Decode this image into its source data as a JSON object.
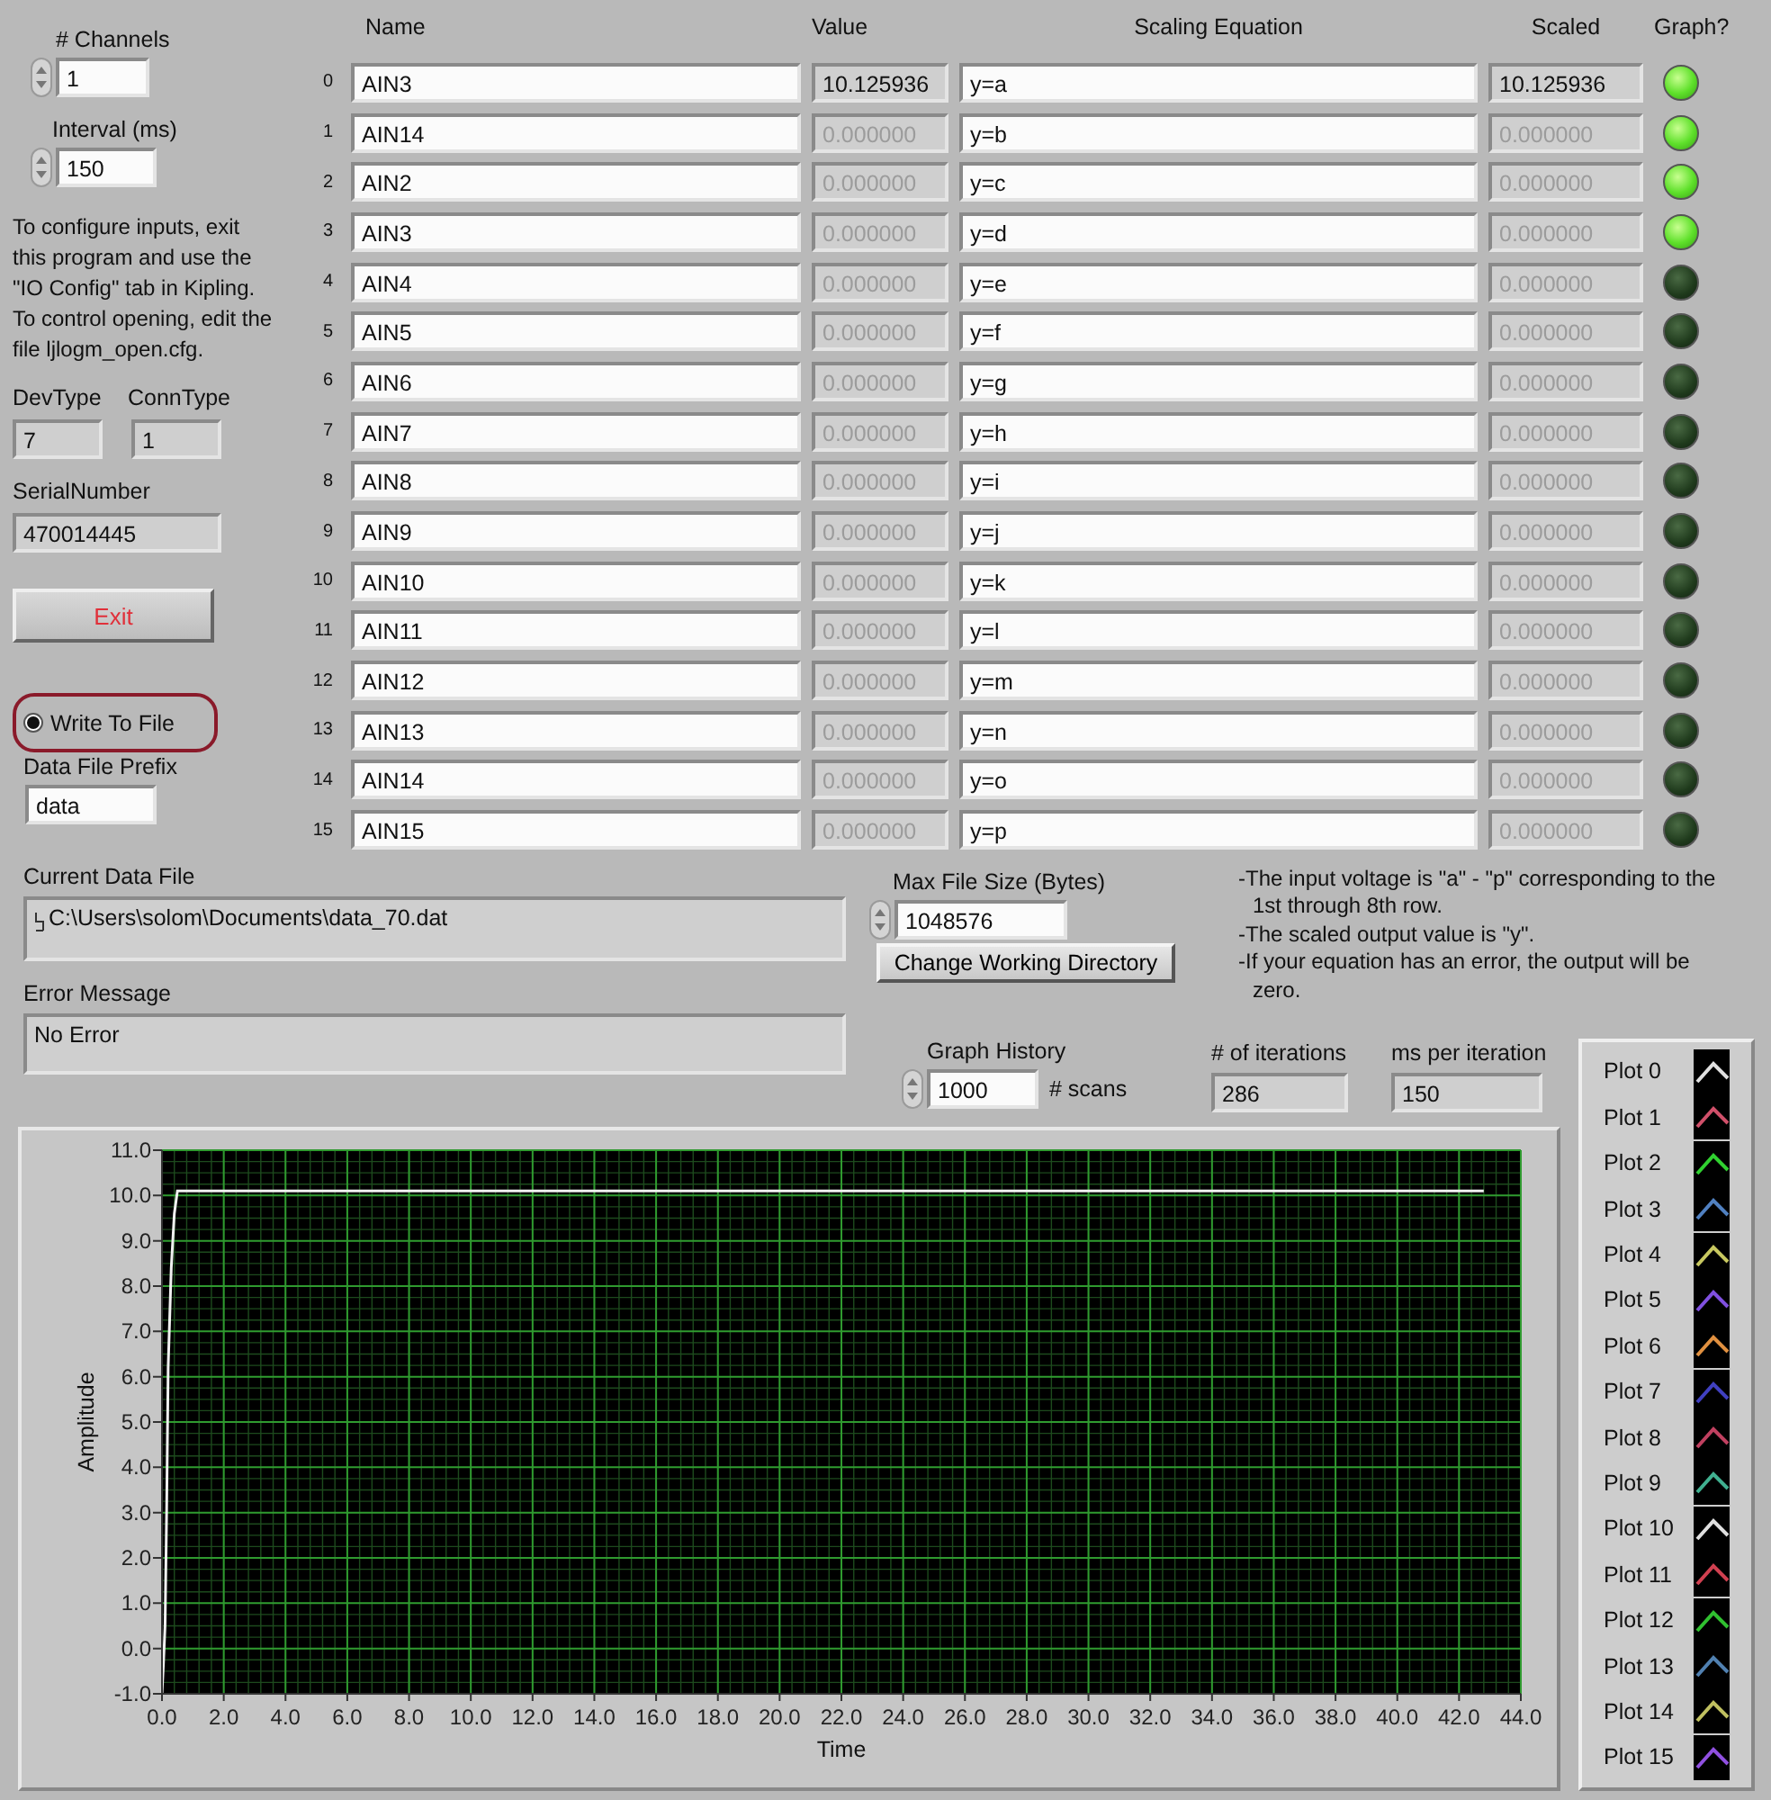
{
  "channels": {
    "label": "# Channels",
    "value": "1"
  },
  "interval": {
    "label": "Interval (ms)",
    "value": "150"
  },
  "instructions": "To configure inputs, exit this program and use the \"IO Config\" tab in Kipling.  To control opening, edit the file ljlogm_open.cfg.",
  "dev_type": {
    "label": "DevType",
    "value": "7"
  },
  "conn_type": {
    "label": "ConnType",
    "value": "1"
  },
  "serial_number": {
    "label": "SerialNumber",
    "value": "470014445"
  },
  "exit_button": "Exit",
  "write_to_file": {
    "label": "Write To File",
    "checked": true
  },
  "data_file_prefix": {
    "label": "Data File Prefix",
    "value": "data"
  },
  "table": {
    "columns": [
      "Name",
      "Value",
      "Scaling Equation",
      "Scaled",
      "Graph?"
    ],
    "rows": [
      {
        "index": "0",
        "name": "AIN3",
        "value": "10.125936",
        "equation": "y=a",
        "scaled": "10.125936",
        "disabled": false,
        "graph": true
      },
      {
        "index": "1",
        "name": "AIN14",
        "value": "0.000000",
        "equation": "y=b",
        "scaled": "0.000000",
        "disabled": true,
        "graph": true
      },
      {
        "index": "2",
        "name": "AIN2",
        "value": "0.000000",
        "equation": "y=c",
        "scaled": "0.000000",
        "disabled": true,
        "graph": true
      },
      {
        "index": "3",
        "name": "AIN3",
        "value": "0.000000",
        "equation": "y=d",
        "scaled": "0.000000",
        "disabled": true,
        "graph": true
      },
      {
        "index": "4",
        "name": "AIN4",
        "value": "0.000000",
        "equation": "y=e",
        "scaled": "0.000000",
        "disabled": true,
        "graph": false
      },
      {
        "index": "5",
        "name": "AIN5",
        "value": "0.000000",
        "equation": "y=f",
        "scaled": "0.000000",
        "disabled": true,
        "graph": false
      },
      {
        "index": "6",
        "name": "AIN6",
        "value": "0.000000",
        "equation": "y=g",
        "scaled": "0.000000",
        "disabled": true,
        "graph": false
      },
      {
        "index": "7",
        "name": "AIN7",
        "value": "0.000000",
        "equation": "y=h",
        "scaled": "0.000000",
        "disabled": true,
        "graph": false
      },
      {
        "index": "8",
        "name": "AIN8",
        "value": "0.000000",
        "equation": "y=i",
        "scaled": "0.000000",
        "disabled": true,
        "graph": false
      },
      {
        "index": "9",
        "name": "AIN9",
        "value": "0.000000",
        "equation": "y=j",
        "scaled": "0.000000",
        "disabled": true,
        "graph": false
      },
      {
        "index": "10",
        "name": "AIN10",
        "value": "0.000000",
        "equation": "y=k",
        "scaled": "0.000000",
        "disabled": true,
        "graph": false
      },
      {
        "index": "11",
        "name": "AIN11",
        "value": "0.000000",
        "equation": "y=l",
        "scaled": "0.000000",
        "disabled": true,
        "graph": false
      },
      {
        "index": "12",
        "name": "AIN12",
        "value": "0.000000",
        "equation": "y=m",
        "scaled": "0.000000",
        "disabled": true,
        "graph": false
      },
      {
        "index": "13",
        "name": "AIN13",
        "value": "0.000000",
        "equation": "y=n",
        "scaled": "0.000000",
        "disabled": true,
        "graph": false
      },
      {
        "index": "14",
        "name": "AIN14",
        "value": "0.000000",
        "equation": "y=o",
        "scaled": "0.000000",
        "disabled": true,
        "graph": false
      },
      {
        "index": "15",
        "name": "AIN15",
        "value": "0.000000",
        "equation": "y=p",
        "scaled": "0.000000",
        "disabled": true,
        "graph": false
      }
    ]
  },
  "current_data_file": {
    "label": "Current Data File",
    "value": "C:\\Users\\solom\\Documents\\data_70.dat"
  },
  "error_message": {
    "label": "Error Message",
    "value": "No Error"
  },
  "max_file_size": {
    "label": "Max File Size (Bytes)",
    "value": "1048576"
  },
  "change_directory_button": "Change Working Directory",
  "notes": [
    "-The input voltage is \"a\" - \"p\" corresponding to the 1st through 8th row.",
    "-The scaled output value is \"y\".",
    "-If your equation has an error, the output will be zero."
  ],
  "graph_history": {
    "label": "Graph History",
    "value": "1000",
    "unit": "# scans"
  },
  "iterations": {
    "label": "# of iterations",
    "value": "286"
  },
  "ms_per_iteration": {
    "label": "ms per iteration",
    "value": "150"
  },
  "chart": {
    "chart_data": {
      "type": "line",
      "grid": true,
      "xlabel": "Time",
      "ylabel": "Amplitude",
      "xlim": [
        0,
        44
      ],
      "ylim": [
        -1,
        11
      ],
      "x": [
        0,
        0.05,
        0.1,
        0.15,
        0.2,
        0.3,
        0.4,
        0.5,
        0.6,
        42.8
      ],
      "series": [
        {
          "color": "#f0f0f0",
          "values": [
            -1.0,
            -0.3,
            0.5,
            3.0,
            6.2,
            8.4,
            9.6,
            10.1,
            10.1,
            10.1
          ]
        }
      ],
      "xticks": [
        {
          "value": 0,
          "label": "0.0"
        },
        {
          "value": 2,
          "label": "2.0"
        },
        {
          "value": 4,
          "label": "4.0"
        },
        {
          "value": 6,
          "label": "6.0"
        },
        {
          "value": 8,
          "label": "8.0"
        },
        {
          "value": 10,
          "label": "10.0"
        },
        {
          "value": 12,
          "label": "12.0"
        },
        {
          "value": 14,
          "label": "14.0"
        },
        {
          "value": 16,
          "label": "16.0"
        },
        {
          "value": 18,
          "label": "18.0"
        },
        {
          "value": 20,
          "label": "20.0"
        },
        {
          "value": 22,
          "label": "22.0"
        },
        {
          "value": 24,
          "label": "24.0"
        },
        {
          "value": 26,
          "label": "26.0"
        },
        {
          "value": 28,
          "label": "28.0"
        },
        {
          "value": 30,
          "label": "30.0"
        },
        {
          "value": 32,
          "label": "32.0"
        },
        {
          "value": 34,
          "label": "34.0"
        },
        {
          "value": 36,
          "label": "36.0"
        },
        {
          "value": 38,
          "label": "38.0"
        },
        {
          "value": 40,
          "label": "40.0"
        },
        {
          "value": 42,
          "label": "42.0"
        },
        {
          "value": 44,
          "label": "44.0"
        }
      ],
      "yticks": [
        {
          "value": -1,
          "label": "-1.0"
        },
        {
          "value": 0,
          "label": "0.0"
        },
        {
          "value": 1,
          "label": "1.0"
        },
        {
          "value": 2,
          "label": "2.0"
        },
        {
          "value": 3,
          "label": "3.0"
        },
        {
          "value": 4,
          "label": "4.0"
        },
        {
          "value": 5,
          "label": "5.0"
        },
        {
          "value": 6,
          "label": "6.0"
        },
        {
          "value": 7,
          "label": "7.0"
        },
        {
          "value": 8,
          "label": "8.0"
        },
        {
          "value": 9,
          "label": "9.0"
        },
        {
          "value": 10,
          "label": "10.0"
        },
        {
          "value": 11,
          "label": "11.0"
        }
      ]
    }
  },
  "legend": [
    {
      "label": "Plot 0",
      "color": "#e0e0e0"
    },
    {
      "label": "Plot 1",
      "color": "#d0506a"
    },
    {
      "label": "Plot 2",
      "color": "#30d030"
    },
    {
      "label": "Plot 3",
      "color": "#5080c0"
    },
    {
      "label": "Plot 4",
      "color": "#c8c860"
    },
    {
      "label": "Plot 5",
      "color": "#8050e0"
    },
    {
      "label": "Plot 6",
      "color": "#e09040"
    },
    {
      "label": "Plot 7",
      "color": "#4040c0"
    },
    {
      "label": "Plot 8",
      "color": "#c04060"
    },
    {
      "label": "Plot 9",
      "color": "#40b090"
    },
    {
      "label": "Plot 10",
      "color": "#e0e0e0"
    },
    {
      "label": "Plot 11",
      "color": "#d04050"
    },
    {
      "label": "Plot 12",
      "color": "#30c030"
    },
    {
      "label": "Plot 13",
      "color": "#5080b0"
    },
    {
      "label": "Plot 14",
      "color": "#c0c060"
    },
    {
      "label": "Plot 15",
      "color": "#9050e0"
    }
  ]
}
